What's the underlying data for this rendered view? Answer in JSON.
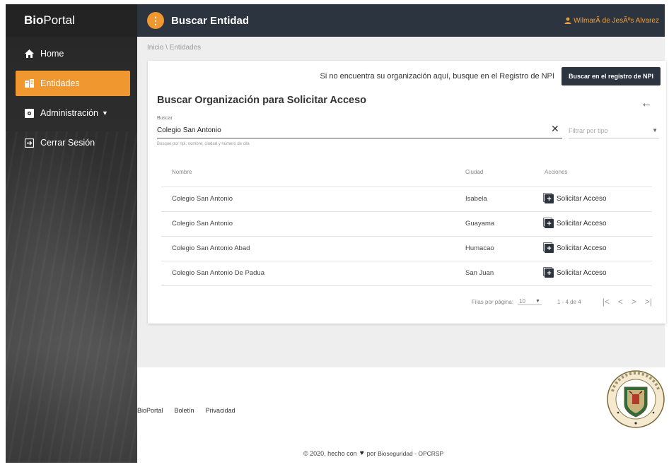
{
  "sidebar": {
    "brand_bold": "Bio",
    "brand_rest": "Portal",
    "items": [
      {
        "label": "Home",
        "icon": "home-icon"
      },
      {
        "label": "Entidades",
        "icon": "building-icon"
      },
      {
        "label": "Administración",
        "icon": "admin-icon"
      },
      {
        "label": "Cerrar Sesión",
        "icon": "logout-icon"
      }
    ]
  },
  "topbar": {
    "menu_glyph": "⋮",
    "title": "Buscar Entidad",
    "user_name": "WilmarÃ de JesÃºs Alvarez"
  },
  "breadcrumb": {
    "home": "Inicio",
    "separator": "\\",
    "current": "Entidades"
  },
  "card": {
    "npi_text": "Si no encuentra su organización aquí, busque en el Registro de NPI",
    "npi_button": "Buscar en el registro de NPI",
    "title": "Buscar Organización para Solicitar Acceso",
    "back_glyph": "←",
    "search_label": "Buscar",
    "search_value": "Colegio San Antonio",
    "search_hint": "Busque por npi, nombre, ciudad y número de cila",
    "clear_glyph": "✕",
    "filter_placeholder": "Filtrar por tipo"
  },
  "table": {
    "headers": [
      "Nombre",
      "Ciudad",
      "Acciones"
    ],
    "action_label": "Solicitar Acceso",
    "rows": [
      {
        "nombre": "Colegio San Antonio",
        "ciudad": "Isabela"
      },
      {
        "nombre": "Colegio San Antonio",
        "ciudad": "Guayama"
      },
      {
        "nombre": "Colegio San Antonio Abad",
        "ciudad": "Humacao"
      },
      {
        "nombre": "Colegio San Antonio De Padua",
        "ciudad": "San Juan"
      }
    ]
  },
  "pagination": {
    "rows_per_page_label": "Filas por página:",
    "rows_per_page_value": "10",
    "range": "1 - 4 de 4",
    "first": "|<",
    "prev": "<",
    "next": ">",
    "last": ">|"
  },
  "footer": {
    "links": [
      "BioPortal",
      "Boletín",
      "Privacidad"
    ],
    "copyright_prefix": "© 2020, hecho con",
    "copyright_by": "por",
    "copyright_org": "Bioseguridad - OPCRSP"
  },
  "colors": {
    "accent": "#f0972f",
    "topbar": "#2c3440",
    "sidebar": "#2e2e2e"
  }
}
